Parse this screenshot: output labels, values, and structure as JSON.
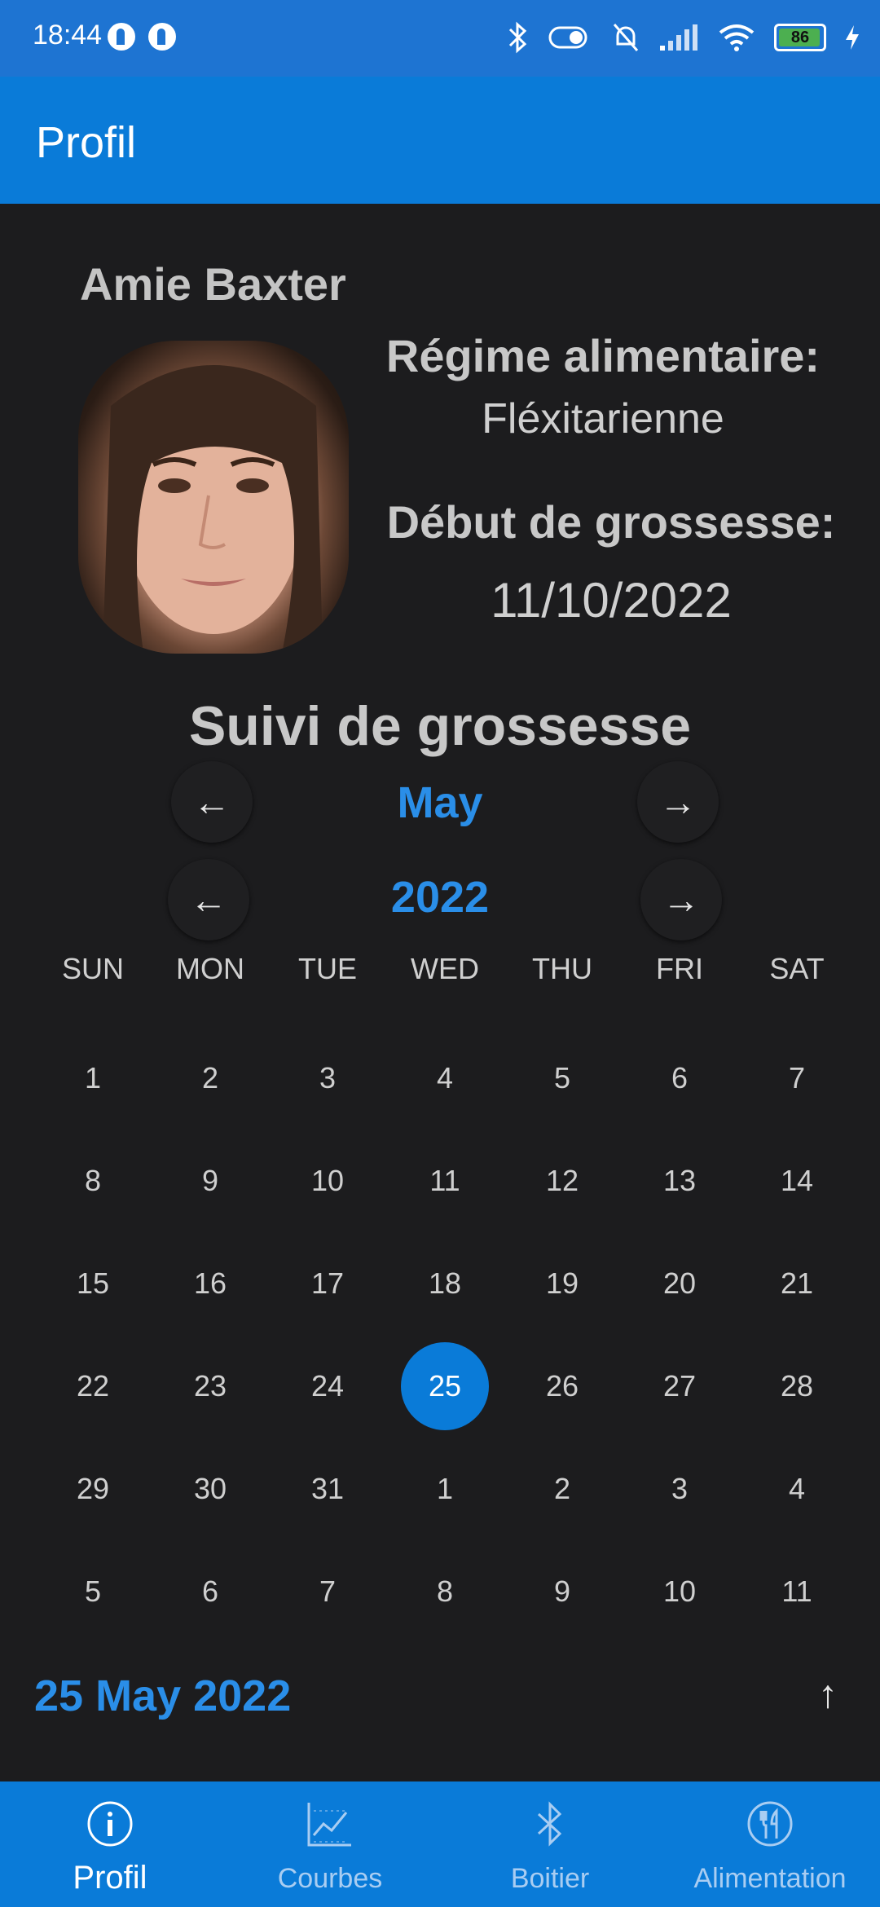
{
  "status_bar": {
    "time": "18:44",
    "battery_level": "86"
  },
  "app_bar": {
    "title": "Profil"
  },
  "profile": {
    "name": "Amie Baxter",
    "diet_label": "Régime alimentaire:",
    "diet_value": "Fléxitarienne",
    "pregnancy_start_label": "Début de grossesse:",
    "pregnancy_start_value": "11/10/2022"
  },
  "tracking": {
    "title": "Suivi de grossesse",
    "month": "May",
    "year": "2022",
    "prev_symbol": "←",
    "next_symbol": "→",
    "weekdays": [
      "SUN",
      "MON",
      "TUE",
      "WED",
      "THU",
      "FRI",
      "SAT"
    ],
    "weeks": [
      [
        "1",
        "2",
        "3",
        "4",
        "5",
        "6",
        "7"
      ],
      [
        "8",
        "9",
        "10",
        "11",
        "12",
        "13",
        "14"
      ],
      [
        "15",
        "16",
        "17",
        "18",
        "19",
        "20",
        "21"
      ],
      [
        "22",
        "23",
        "24",
        "25",
        "26",
        "27",
        "28"
      ],
      [
        "29",
        "30",
        "31",
        "1",
        "2",
        "3",
        "4"
      ],
      [
        "5",
        "6",
        "7",
        "8",
        "9",
        "10",
        "11"
      ]
    ],
    "selected_day": "25",
    "selected_date": "25 May 2022",
    "scroll_up_symbol": "↑"
  },
  "bottom_nav": [
    {
      "label": "Profil",
      "icon": "info-icon",
      "active": true
    },
    {
      "label": "Courbes",
      "icon": "chart-icon",
      "active": false
    },
    {
      "label": "Boitier",
      "icon": "bluetooth-icon",
      "active": false
    },
    {
      "label": "Alimentation",
      "icon": "cutlery-icon",
      "active": false
    }
  ],
  "colors": {
    "primary": "#0a7bd8",
    "accent": "#2a8ee8",
    "background": "#1c1c1e"
  }
}
